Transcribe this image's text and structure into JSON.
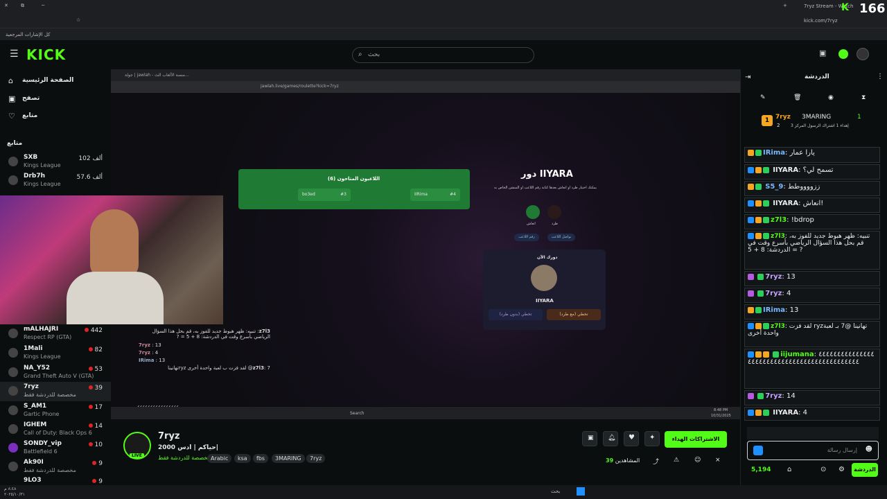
{
  "browser": {
    "tab_title": "7ryz Stream - Watch",
    "url": "kick.com/7ryz",
    "bookmarks_label": "كل الإشارات المرجعية",
    "overlay_count": "166"
  },
  "header": {
    "logo": "KICK",
    "search_placeholder": "بحث"
  },
  "sidebar": {
    "nav": [
      {
        "label": "الصفحة الرئيسية",
        "icon": "home-icon"
      },
      {
        "label": "تصفح",
        "icon": "browse-icon"
      },
      {
        "label": "متابع",
        "icon": "heart-icon"
      }
    ],
    "following_title": "متابع",
    "channels": [
      {
        "name": "SXB",
        "category": "Kings League",
        "viewers": "102 ألف"
      },
      {
        "name": "Drb7h",
        "category": "Kings League",
        "viewers": "57.6 ألف"
      },
      {
        "name": "mALHAJRI",
        "category": "Respect RP (GTA)",
        "viewers": "442"
      },
      {
        "name": "1Mali",
        "category": "Kings League",
        "viewers": "82"
      },
      {
        "name": "NA_Y52",
        "category": "Grand Theft Auto V (GTA)",
        "viewers": "53"
      },
      {
        "name": "7ryz",
        "category": "مخصصة للدردشة فقط",
        "viewers": "39"
      },
      {
        "name": "S_AM1",
        "category": "Gartic Phone",
        "viewers": "17"
      },
      {
        "name": "IGHEM",
        "category": "Call of Duty: Black Ops 6",
        "viewers": "14"
      },
      {
        "name": "SONDY_vip",
        "category": "Battlefield 6",
        "viewers": "10"
      },
      {
        "name": "Ak90I",
        "category": "مخصصة للدردشة فقط",
        "viewers": "9"
      },
      {
        "name": "9LO3",
        "category": "",
        "viewers": "9"
      }
    ]
  },
  "game": {
    "inner_tab": "جولة | jawlah - منصة الألعاب الث...",
    "inner_url": "jawlah.live/games/roulette?kick=7ryz",
    "players_title": "اللاعبون المتاحون (6)",
    "players": [
      {
        "num": "#3",
        "name": "bo3ed"
      },
      {
        "num": "#4",
        "name": "IIRima"
      }
    ],
    "turn_title": "دور IIYARA",
    "turn_desc": "يمكنك اختيار طرد او انعاش بعدها كتابة رقم اللاعب او المنشن الخاص به",
    "opt_revive": "انعاش",
    "opt_kick": "طرد",
    "pill1": "رقم اللاعب",
    "pill2": "تواصل اللاعب",
    "your_turn": "دورك الآن",
    "player_name": "IIYARA",
    "skip_with": "تخطي (مع طرد)",
    "skip_without": "تخطي (بدون طرد)",
    "overlay_chat": [
      {
        "user": "z7l3",
        "text": "تنبيه: ظهر هبوط جديد للفوز به، قم بحل هذا السؤال الرياضي بأسرع وقت في الدردشة: 8 + 5 = ?"
      },
      {
        "user": "7ryz",
        "text": "13"
      },
      {
        "user": "7ryz",
        "text": "4"
      },
      {
        "user": "IRima",
        "text": "13"
      },
      {
        "user": "z7l3",
        "text": "7@ لقد فزت ب لعبة واحدة أخرى ryzتهانينا"
      }
    ],
    "bottom_text": "٤٤٤٤٤٤٤٤٤٤٤٤٤٤٤٤",
    "inner_search": "Search",
    "inner_time": "8:48 PM",
    "inner_date": "10/31/2025"
  },
  "stream": {
    "name": "7ryz",
    "title": "حياكم | ادس 2000|",
    "category": "مخصصة للدردشة فقط",
    "tags": [
      "Arabic",
      "ksa",
      "fbs",
      "3MARING",
      "7ryz"
    ],
    "live": "LIVE",
    "subscribe_label": "الاشتراكات الهداء",
    "viewers": "39",
    "viewers_label": "المشاهدين"
  },
  "chat": {
    "title": "الدردشة",
    "leaderboard": [
      {
        "rank": "1",
        "name": "7ryz",
        "count": "2"
      },
      {
        "name": "3MARING",
        "count": "1",
        "desc": "إهداء 1 اشتراك الرسول المركز 3"
      }
    ],
    "messages": [
      {
        "user": "IRima",
        "text": "يارا عمار"
      },
      {
        "user": "IIYARA",
        "text": "تسمح لي؟"
      },
      {
        "user": "S5_9",
        "text": "ززووووطط"
      },
      {
        "user": "IIYARA",
        "text": "انعاش!"
      },
      {
        "user": "z7l3",
        "text": "!bdrop"
      },
      {
        "user": "z7l3",
        "text": "تنبيه: ظهر هبوط جديد للفوز به، قم بحل هذا السؤال الرياضي بأسرع وقت في الدردشة: 8 + 5 = ?"
      },
      {
        "user": "7ryz",
        "text": "13"
      },
      {
        "user": "7ryz",
        "text": "4"
      },
      {
        "user": "IRima",
        "text": "13"
      },
      {
        "user": "z7l3",
        "text": "لقد فزت ryzتهانينا @7 بـ لعبة واحدة أخرى"
      },
      {
        "user": "iijumana",
        "text": "٤٤٤٤٤٤٤٤٤٤٤٤٤٤٤٤٤٤٤٤٤٤٤٤٤٤٤٤٤٤٤٤٤٤٤٤٤٤٤٤٤٤٤٤٤"
      },
      {
        "user": "7ryz",
        "text": "14"
      },
      {
        "user": "IIYARA",
        "text": "4"
      }
    ],
    "input_placeholder": "إرسال رسالة",
    "points": "5,194",
    "send_label": "الدردشة"
  },
  "taskbar": {
    "time": "٨:٤٨ م",
    "date": "٢٠٢٥/١٠/٣١",
    "search": "بحث"
  },
  "colors": {
    "accent": "#53fc18",
    "bg": "#0b0e0f"
  }
}
